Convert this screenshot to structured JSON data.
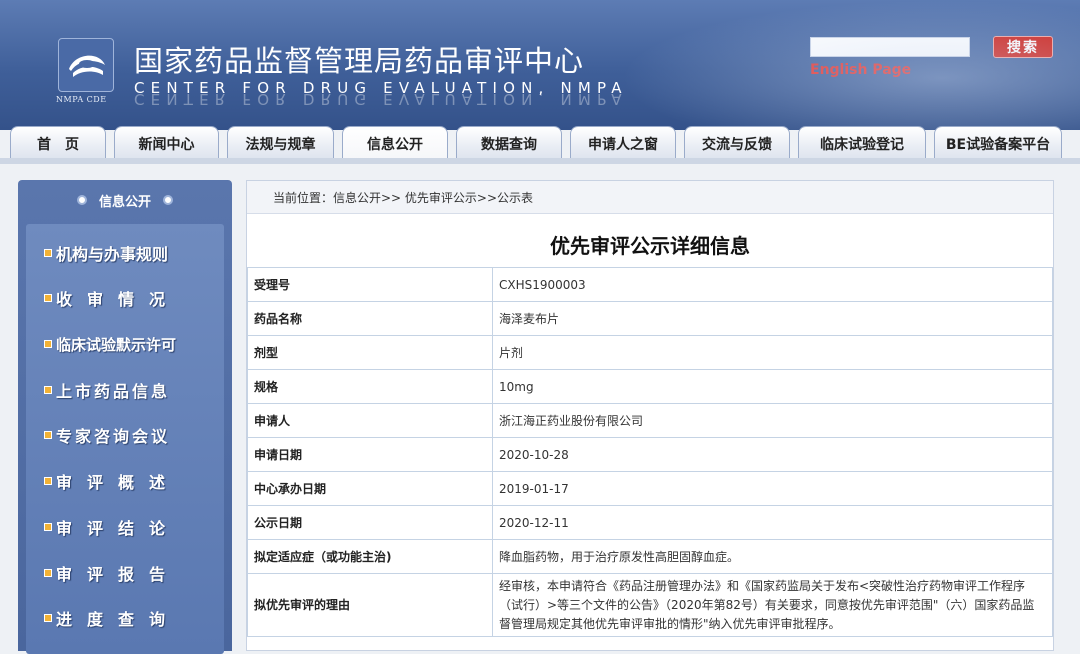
{
  "header": {
    "logo_text": "NMPA CDE",
    "title": "国家药品监督管理局药品审评中心",
    "subtitle": "CENTER FOR DRUG EVALUATION, NMPA",
    "search_button": "搜索",
    "english_link": "English Page"
  },
  "nav": {
    "tabs": [
      "首　页",
      "新闻中心",
      "法规与规章",
      "信息公开",
      "数据查询",
      "申请人之窗",
      "交流与反馈",
      "临床试验登记",
      "BE试验备案平台"
    ],
    "active_index": 3
  },
  "sidebar": {
    "title": "信息公开",
    "items": [
      "机构与办事规则",
      "收审情况",
      "临床试验默示许可",
      "上市药品信息",
      "专家咨询会议",
      "审评概述",
      "审评结论",
      "审评报告",
      "进度查询"
    ]
  },
  "breadcrumb": "当前位置：信息公开>> 优先审评公示>>公示表",
  "page_title": "优先审评公示详细信息",
  "detail_rows": [
    {
      "label": "受理号",
      "value": "CXHS1900003"
    },
    {
      "label": "药品名称",
      "value": "海泽麦布片"
    },
    {
      "label": "剂型",
      "value": "片剂"
    },
    {
      "label": "规格",
      "value": "10mg"
    },
    {
      "label": "申请人",
      "value": "浙江海正药业股份有限公司"
    },
    {
      "label": "申请日期",
      "value": "2020-10-28"
    },
    {
      "label": "中心承办日期",
      "value": "2019-01-17"
    },
    {
      "label": "公示日期",
      "value": "2020-12-11"
    },
    {
      "label": "拟定适应症（或功能主治)",
      "value": "降血脂药物，用于治疗原发性高胆固醇血症。"
    },
    {
      "label": "拟优先审评的理由",
      "value": "经审核，本申请符合《药品注册管理办法》和《国家药监局关于发布<突破性治疗药物审评工作程序（试行）>等三个文件的公告》（2020年第82号）有关要求，同意按优先审评范围\"（六）国家药品监督管理局规定其他优先审评审批的情形\"纳入优先审评审批程序。"
    }
  ]
}
